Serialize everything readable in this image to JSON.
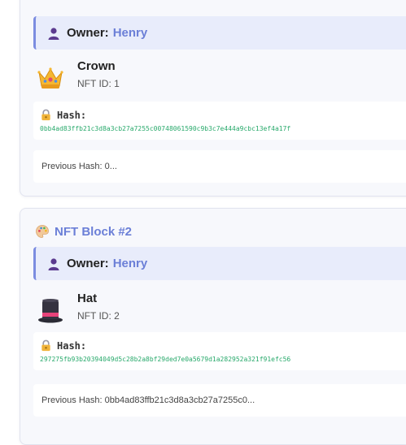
{
  "owner_label": "Owner:",
  "hash_label": "Hash:",
  "colors": {
    "accent": "#6b7fd7",
    "hash_green": "#28a96b",
    "owner_bar_bg": "#e8ecfb",
    "card_bg": "#f7f8fc"
  },
  "blocks": [
    {
      "title": "",
      "owner": "Henry",
      "item_name": "Crown",
      "item_icon": "crown-icon",
      "nft_id": "NFT ID: 1",
      "hash": "0bb4ad83ffb21c3d8a3cb27a7255c00748061590c9b3c7e444a9cbc13ef4a17f",
      "previous_hash": "Previous Hash: 0..."
    },
    {
      "title": "NFT Block #2",
      "owner": "Henry",
      "item_name": "Hat",
      "item_icon": "top-hat-icon",
      "nft_id": "NFT ID: 2",
      "hash": "297275fb93b20394049d5c28b2a8bf29ded7e0a5679d1a282952a321f91efc56",
      "previous_hash": "Previous Hash: 0bb4ad83ffb21c3d8a3cb27a7255c0..."
    }
  ]
}
